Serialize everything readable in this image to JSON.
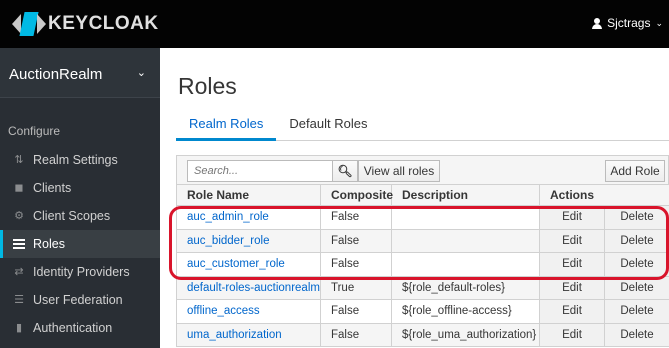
{
  "app": {
    "logo_text": "KEYCLOAK",
    "user_name": "Sjctrags"
  },
  "sidebar": {
    "realm_name": "AuctionRealm",
    "section_label": "Configure",
    "items": [
      {
        "label": "Realm Settings",
        "icon": "sliders-icon"
      },
      {
        "label": "Clients",
        "icon": "cube-icon"
      },
      {
        "label": "Client Scopes",
        "icon": "cubes-icon"
      },
      {
        "label": "Roles",
        "icon": "list-icon",
        "active": true
      },
      {
        "label": "Identity Providers",
        "icon": "exchange-icon"
      },
      {
        "label": "User Federation",
        "icon": "database-icon"
      },
      {
        "label": "Authentication",
        "icon": "lock-icon"
      }
    ]
  },
  "main": {
    "title": "Roles",
    "tabs": [
      {
        "label": "Realm Roles",
        "active": true
      },
      {
        "label": "Default Roles",
        "active": false
      }
    ],
    "toolbar": {
      "search_placeholder": "Search...",
      "view_all_label": "View all roles",
      "add_role_label": "Add Role"
    },
    "table": {
      "columns": [
        "Role Name",
        "Composite",
        "Description",
        "Actions"
      ],
      "rows": [
        {
          "name": "auc_admin_role",
          "composite": "False",
          "description": "",
          "edit": "Edit",
          "delete": "Delete"
        },
        {
          "name": "auc_bidder_role",
          "composite": "False",
          "description": "",
          "edit": "Edit",
          "delete": "Delete"
        },
        {
          "name": "auc_customer_role",
          "composite": "False",
          "description": "",
          "edit": "Edit",
          "delete": "Delete"
        },
        {
          "name": "default-roles-auctionrealm",
          "composite": "True",
          "description": "${role_default-roles}",
          "edit": "Edit",
          "delete": "Delete"
        },
        {
          "name": "offline_access",
          "composite": "False",
          "description": "${role_offline-access}",
          "edit": "Edit",
          "delete": "Delete"
        },
        {
          "name": "uma_authorization",
          "composite": "False",
          "description": "${role_uma_authorization}",
          "edit": "Edit",
          "delete": "Delete"
        }
      ]
    }
  },
  "colors": {
    "accent": "#00b9e4",
    "link": "#0066cc",
    "highlight": "#d9142b",
    "topbar": "#030303",
    "sidebar": "#292e34"
  }
}
